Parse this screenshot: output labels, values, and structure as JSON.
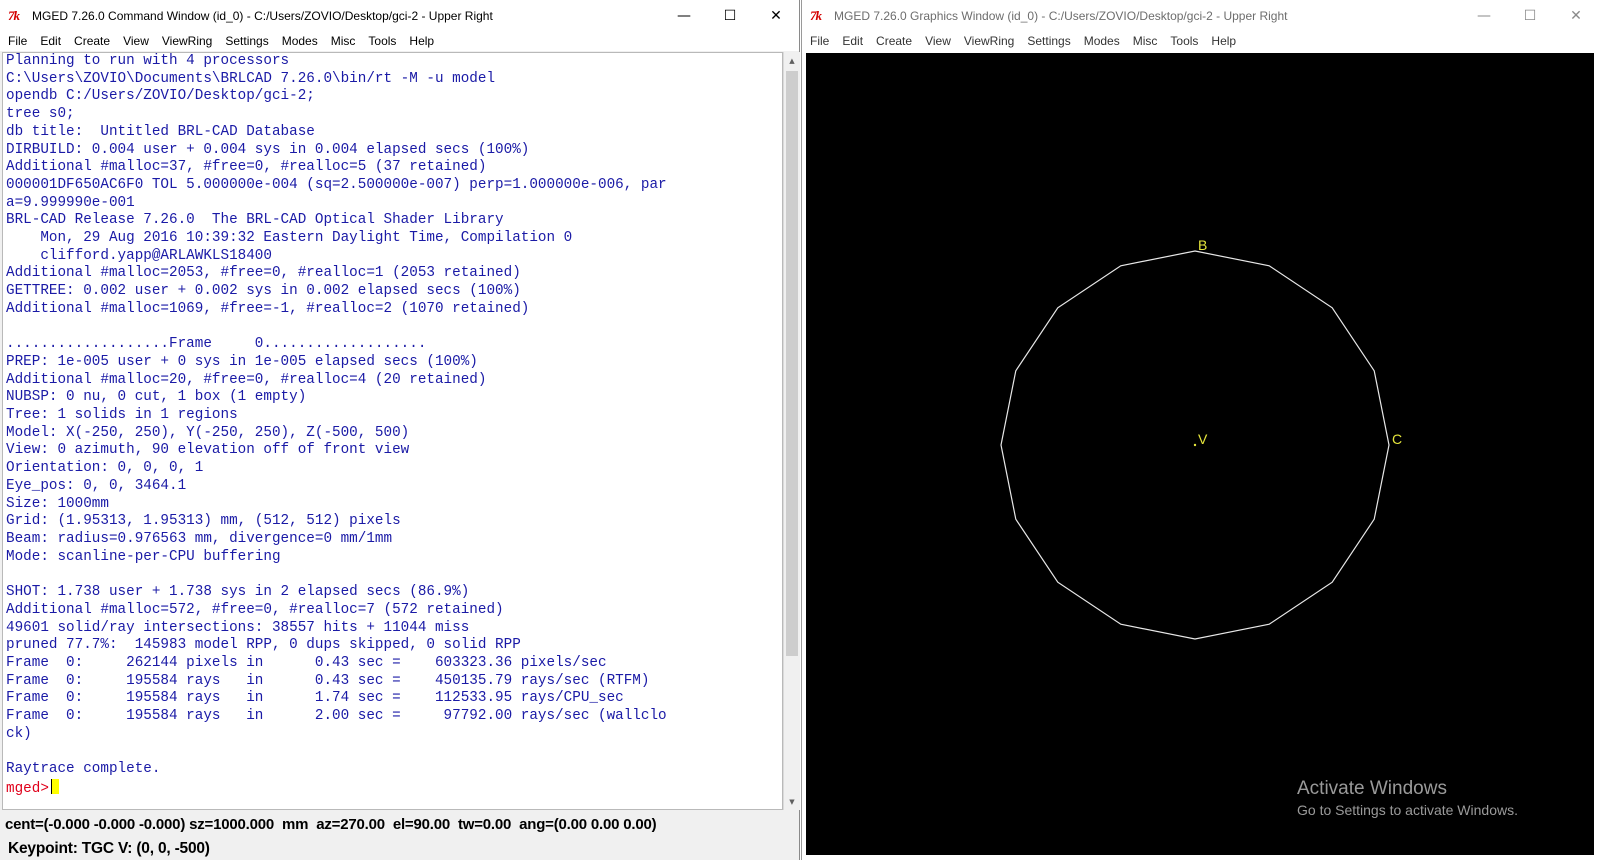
{
  "command_window": {
    "logo": "7k",
    "title": "MGED 7.26.0 Command Window (id_0) - C:/Users/ZOVIO/Desktop/gci-2 - Upper Right",
    "controls": {
      "minimize": "—",
      "maximize": "☐",
      "close": "✕"
    },
    "menu": [
      "File",
      "Edit",
      "Create",
      "View",
      "ViewRing",
      "Settings",
      "Modes",
      "Misc",
      "Tools",
      "Help"
    ],
    "console_lines": [
      "Planning to run with 4 processors",
      "C:\\Users\\ZOVIO\\Documents\\BRLCAD 7.26.0\\bin/rt -M -u model",
      "opendb C:/Users/ZOVIO/Desktop/gci-2;",
      "tree s0;",
      "db title:  Untitled BRL-CAD Database",
      "DIRBUILD: 0.004 user + 0.004 sys in 0.004 elapsed secs (100%)",
      "Additional #malloc=37, #free=0, #realloc=5 (37 retained)",
      "000001DF650AC6F0 TOL 5.000000e-004 (sq=2.500000e-007) perp=1.000000e-006, par",
      "a=9.999990e-001",
      "BRL-CAD Release 7.26.0  The BRL-CAD Optical Shader Library",
      "    Mon, 29 Aug 2016 10:39:32 Eastern Daylight Time, Compilation 0",
      "    clifford.yapp@ARLAWKLS18400",
      "Additional #malloc=2053, #free=0, #realloc=1 (2053 retained)",
      "GETTREE: 0.002 user + 0.002 sys in 0.002 elapsed secs (100%)",
      "Additional #malloc=1069, #free=-1, #realloc=2 (1070 retained)",
      "",
      "...................Frame     0...................",
      "PREP: 1e-005 user + 0 sys in 1e-005 elapsed secs (100%)",
      "Additional #malloc=20, #free=0, #realloc=4 (20 retained)",
      "NUBSP: 0 nu, 0 cut, 1 box (1 empty)",
      "Tree: 1 solids in 1 regions",
      "Model: X(-250, 250), Y(-250, 250), Z(-500, 500)",
      "View: 0 azimuth, 90 elevation off of front view",
      "Orientation: 0, 0, 0, 1",
      "Eye_pos: 0, 0, 3464.1",
      "Size: 1000mm",
      "Grid: (1.95313, 1.95313) mm, (512, 512) pixels",
      "Beam: radius=0.976563 mm, divergence=0 mm/1mm",
      "Mode: scanline-per-CPU buffering",
      "",
      "SHOT: 1.738 user + 1.738 sys in 2 elapsed secs (86.9%)",
      "Additional #malloc=572, #free=0, #realloc=7 (572 retained)",
      "49601 solid/ray intersections: 38557 hits + 11044 miss",
      "pruned 77.7%:  145983 model RPP, 0 dups skipped, 0 solid RPP",
      "Frame  0:     262144 pixels in      0.43 sec =    603323.36 pixels/sec",
      "Frame  0:     195584 rays   in      0.43 sec =    450135.79 rays/sec (RTFM)",
      "Frame  0:     195584 rays   in      1.74 sec =    112533.95 rays/CPU_sec",
      "Frame  0:     195584 rays   in      2.00 sec =     97792.00 rays/sec (wallclo",
      "ck)",
      "",
      "Raytrace complete."
    ],
    "prompt": "mged>",
    "status_line": "cent=(-0.000 -0.000 -0.000) sz=1000.000  mm  az=270.00  el=90.00  tw=0.00  ang=(0.00 0.00 0.00)",
    "keypoint_line": "Keypoint: TGC V: (0, 0, -500)"
  },
  "graphics_window": {
    "logo": "7k",
    "title": "MGED 7.26.0 Graphics Window (id_0) - C:/Users/ZOVIO/Desktop/gci-2 - Upper Right",
    "controls": {
      "minimize": "—",
      "maximize": "☐",
      "close": "✕"
    },
    "menu": [
      "File",
      "Edit",
      "Create",
      "View",
      "ViewRing",
      "Settings",
      "Modes",
      "Misc",
      "Tools",
      "Help"
    ],
    "wireframe_color": "#e8e8e8",
    "label_color": "#e6e63c",
    "labels": {
      "b": "B",
      "c": "C",
      "v": "V"
    },
    "background": "#000000"
  },
  "watermark": {
    "title": "Activate Windows",
    "subtitle": "Go to Settings to activate Windows."
  }
}
